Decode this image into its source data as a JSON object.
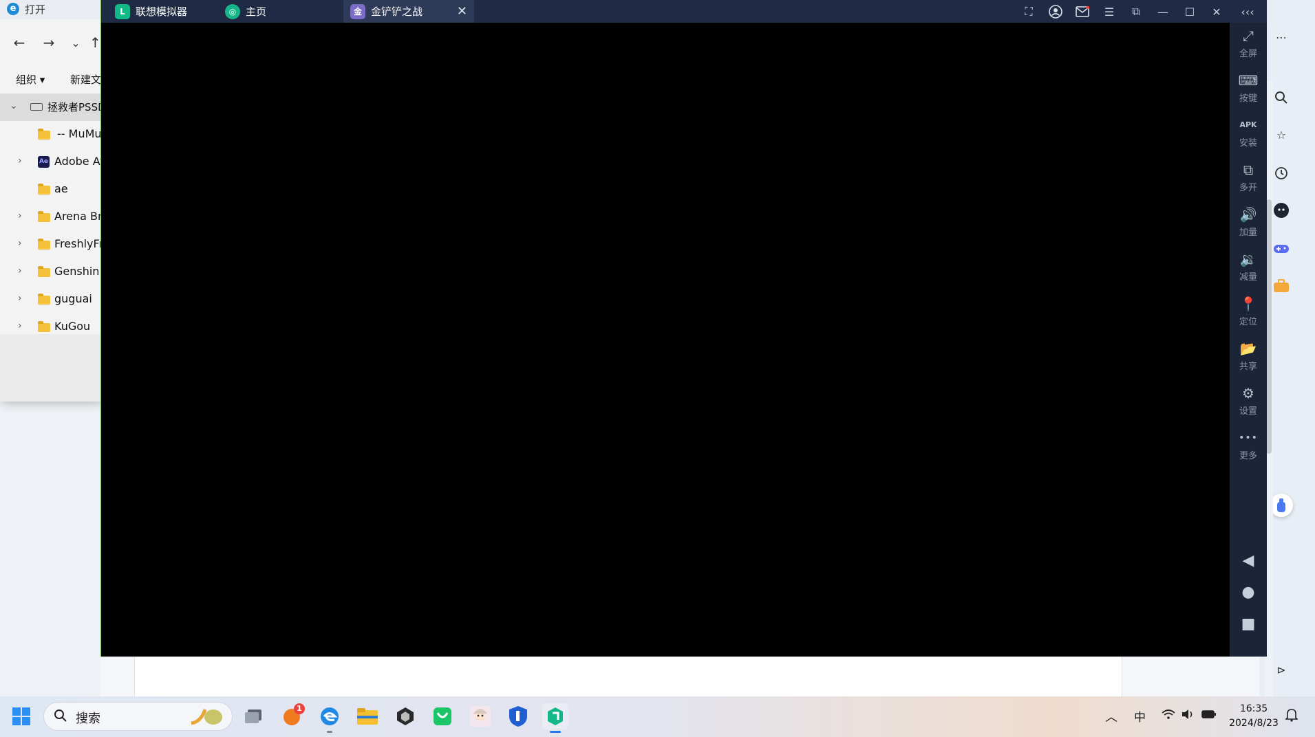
{
  "file_dialog": {
    "title": "打开",
    "nav": {
      "back": "←",
      "forward": "→",
      "dropdown": "⌄",
      "up": "↑"
    },
    "commands": {
      "organize": "组织 ▾",
      "new_folder": "新建文"
    },
    "tree": [
      {
        "label": "拯救者PSSD",
        "expanded": true,
        "selected": true
      },
      {
        "label": "-- MuMu",
        "expandable": false
      },
      {
        "label": "Adobe Af",
        "expandable": true
      },
      {
        "label": "ae",
        "expandable": false
      },
      {
        "label": "Arena Bre",
        "expandable": true
      },
      {
        "label": "FreshlyFr",
        "expandable": true
      },
      {
        "label": "Genshin I",
        "expandable": true
      },
      {
        "label": "guguai",
        "expandable": true
      },
      {
        "label": "KuGou",
        "expandable": true
      }
    ]
  },
  "emulator": {
    "tabs": [
      {
        "label": "联想模拟器",
        "icon": "lenovo-emulator-icon"
      },
      {
        "label": "主页",
        "icon": "home-icon"
      },
      {
        "label": "金铲铲之战",
        "icon": "game-icon",
        "active": true
      }
    ],
    "sidebar": [
      {
        "label": "全屏",
        "icon": "⤢"
      },
      {
        "label": "按键",
        "icon": "⌨"
      },
      {
        "label": "安装",
        "icon": "APK"
      },
      {
        "label": "多开",
        "icon": "⧉"
      },
      {
        "label": "加量",
        "icon": "🔊"
      },
      {
        "label": "减量",
        "icon": "🔉"
      },
      {
        "label": "定位",
        "icon": "📍"
      },
      {
        "label": "共享",
        "icon": "📂"
      },
      {
        "label": "设置",
        "icon": "⚙"
      },
      {
        "label": "更多",
        "icon": "•••"
      }
    ],
    "nav_keys": [
      "◀",
      "●",
      "■"
    ]
  },
  "taskbar": {
    "search_placeholder": "搜索",
    "badge_count": "1",
    "tray": {
      "ime": "中",
      "time": "16:35",
      "date": "2024/8/23"
    }
  },
  "colors": {
    "emulator_bar": "#1f2a44",
    "emulator_side": "#1c2538",
    "emulator_border": "#7ab54a"
  }
}
